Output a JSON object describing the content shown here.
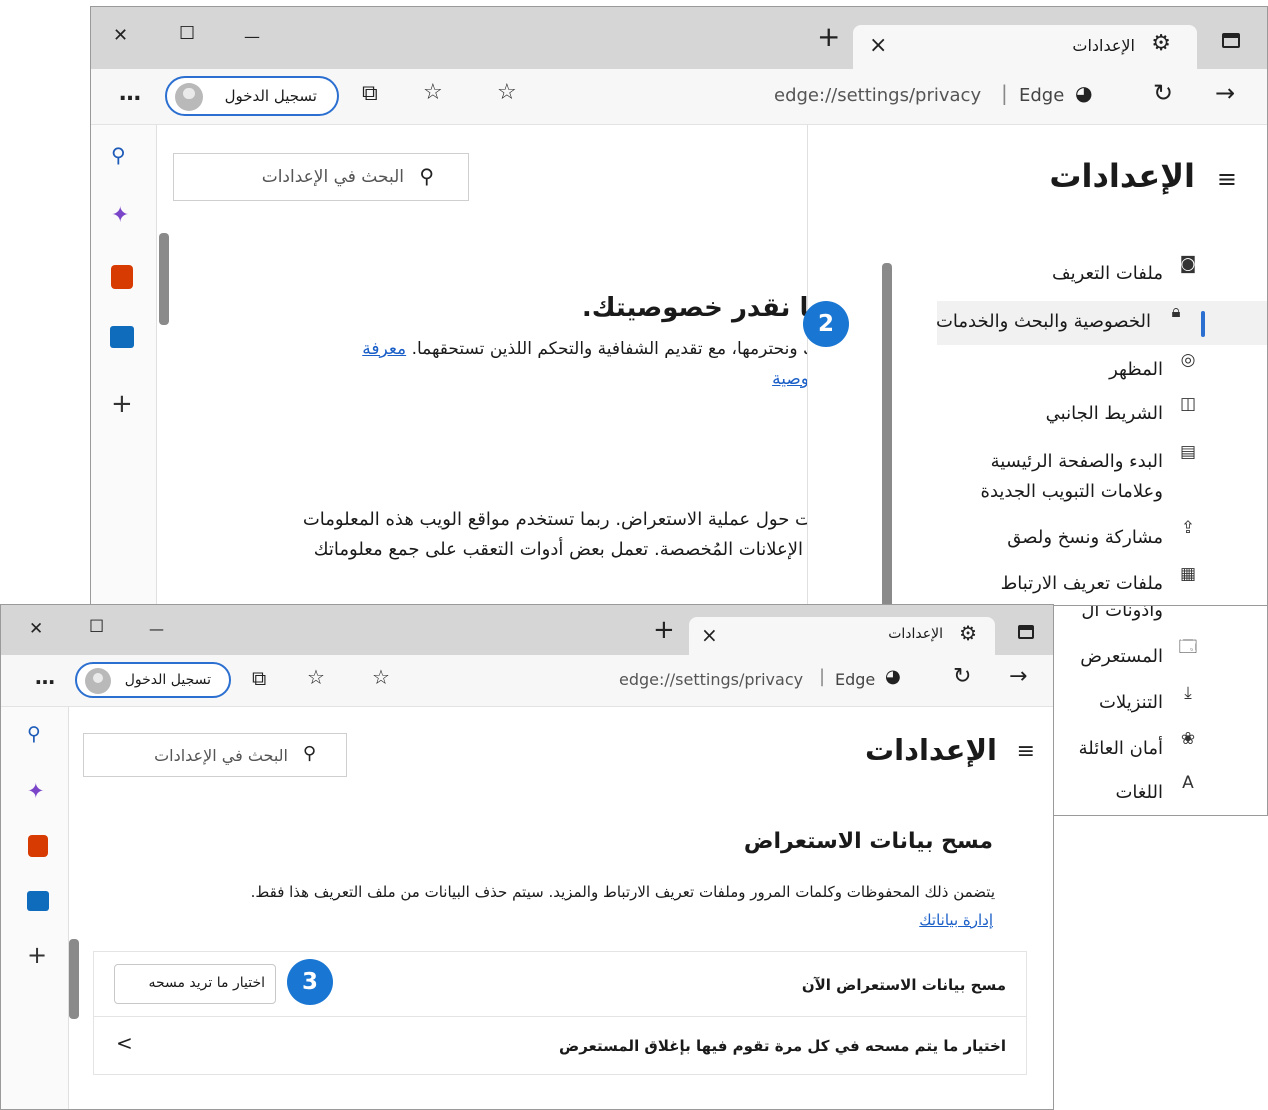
{
  "back_window": {
    "tab_title": "الإعدادات",
    "tab_close": "×",
    "new_tab": "+",
    "win_controls": {
      "close": "✕",
      "maximize": "☐",
      "minimize": "—"
    },
    "address_url": "edge://settings/privacy",
    "address_brand": "Edge",
    "sign_in_label": "تسجيل الدخول",
    "more_menu": "…",
    "settings_heading": "الإعدادات",
    "search_placeholder": "البحث في الإعدادات",
    "nav_items": [
      {
        "icon": "profile-icon",
        "label": "ملفات التعريف"
      },
      {
        "icon": "lock-icon",
        "label": "الخصوصية والبحث والخدمات"
      },
      {
        "icon": "palette-icon",
        "label": "المظهر"
      },
      {
        "icon": "sidebar-icon",
        "label": "الشريط الجانبي"
      },
      {
        "icon": "home-icon",
        "label": "البدء والصفحة الرئيسية",
        "label2": "وعلامات التبويب الجديدة"
      },
      {
        "icon": "share-icon",
        "label": "مشاركة ونسخ ولصق"
      },
      {
        "icon": "cookies-icon",
        "label": "ملفات تعريف الارتباط",
        "label2": "وأذونات ال"
      },
      {
        "icon": "browser-icon",
        "label": "المستعرض"
      },
      {
        "icon": "download-icon",
        "label": "التنزيلات"
      },
      {
        "icon": "family-icon",
        "label": "أمان العائلة"
      },
      {
        "icon": "languages-icon",
        "label": "اللغات"
      }
    ],
    "privacy_heading": "نا نقدر خصوصيتك.",
    "privacy_line1_text": "ك ونحترمها، مع تقديم الشفافية والتحكم اللذين تستحقهما.",
    "privacy_line1_link": "معرفة",
    "privacy_line2_link": "وصية",
    "tracking_line1": "ات حول عملية الاستعراض. ربما تستخدم مواقع الويب هذه المعلومات",
    "tracking_line2": "الإعلانات المُخصصة. تعمل بعض أدوات التعقب على جمع معلوماتك"
  },
  "front_window": {
    "tab_title": "الإعدادات",
    "tab_close": "×",
    "new_tab": "+",
    "win_controls": {
      "close": "✕",
      "maximize": "☐",
      "minimize": "—"
    },
    "address_url": "edge://settings/privacy",
    "address_brand": "Edge",
    "sign_in_label": "تسجيل الدخول",
    "more_menu": "…",
    "settings_heading": "الإعدادات",
    "search_placeholder": "البحث في الإعدادات",
    "section_title": "مسح بيانات الاستعراض",
    "section_desc": "يتضمن ذلك المحفوظات وكلمات المرور وملفات تعريف الارتباط والمزيد. سيتم حذف البيانات من ملف التعريف هذا فقط.",
    "manage_link": "إدارة بياناتك",
    "clear_now_label": "مسح بيانات الاستعراض الآن",
    "choose_button": "اختيار ما تريد مسحه",
    "on_close_label": "اختيار ما يتم مسحه في كل مرة تقوم فيها بإغلاق المستعرض",
    "chevron": "<"
  },
  "callouts": {
    "step2": "2",
    "step3": "3"
  },
  "colors": {
    "accent": "#1976d2",
    "link": "#1a5fc7",
    "selection_bar": "#2b6fd0"
  }
}
